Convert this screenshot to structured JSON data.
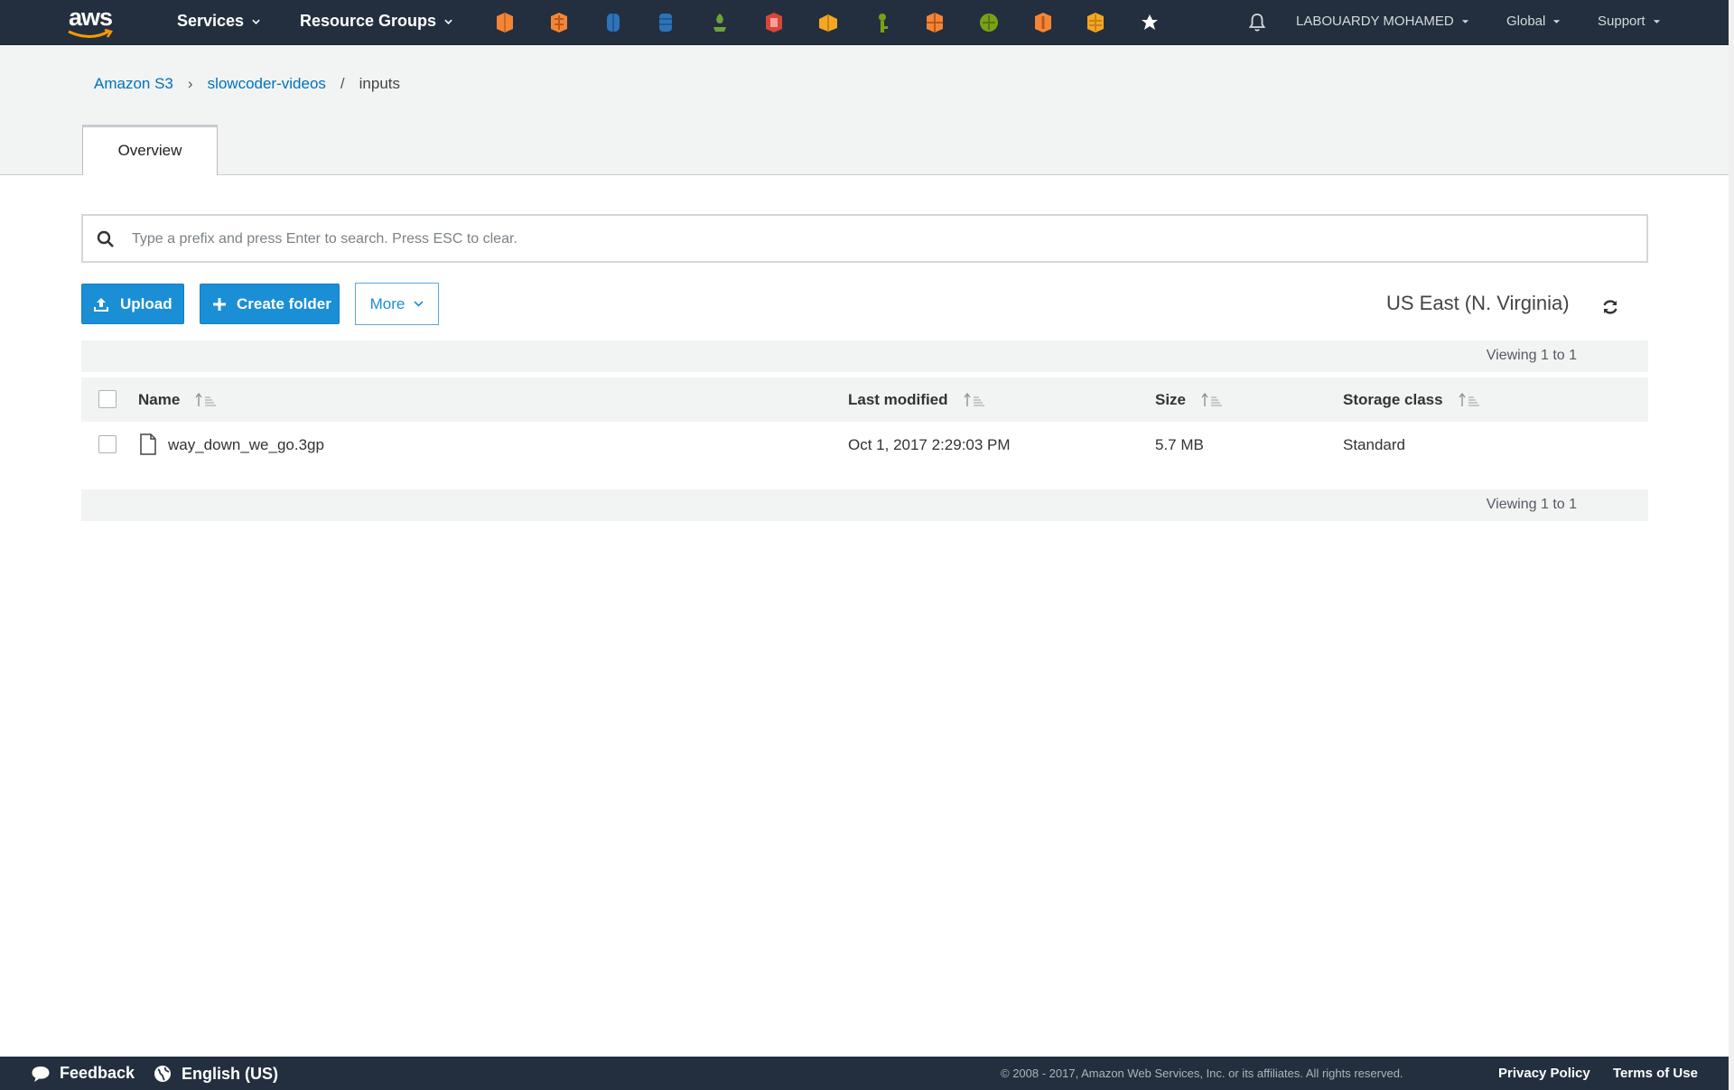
{
  "topnav": {
    "logo_text": "aws",
    "services_label": "Services",
    "resource_groups_label": "Resource Groups",
    "shortcut_colors": [
      "#f58536",
      "#f58536",
      "#2e73b8",
      "#2e73b8",
      "#6ba539",
      "#d9453a",
      "#f5a623",
      "#7aa116",
      "#f58536",
      "#7aa116",
      "#f58536",
      "#f5a623"
    ],
    "account_label": "LABOUARDY MOHAMED",
    "region_menu_label": "Global",
    "support_label": "Support"
  },
  "breadcrumb": {
    "root": "Amazon S3",
    "bucket": "slowcoder-videos",
    "folder": "inputs"
  },
  "tabs": {
    "overview_label": "Overview"
  },
  "search": {
    "placeholder": "Type a prefix and press Enter to search. Press ESC to clear.",
    "value": ""
  },
  "actions": {
    "upload_label": "Upload",
    "create_folder_label": "Create folder",
    "more_label": "More"
  },
  "region": {
    "label": "US East (N. Virginia)"
  },
  "table": {
    "viewing_top": "Viewing 1 to 1",
    "viewing_bottom": "Viewing 1 to 1",
    "headers": {
      "name": "Name",
      "last_modified": "Last modified",
      "size": "Size",
      "storage_class": "Storage class"
    },
    "rows": [
      {
        "name": "way_down_we_go.3gp",
        "last_modified": "Oct 1, 2017 2:29:03 PM",
        "size": "5.7 MB",
        "storage_class": "Standard"
      }
    ]
  },
  "footer": {
    "feedback_label": "Feedback",
    "language_label": "English (US)",
    "copyright": "© 2008 - 2017, Amazon Web Services, Inc. or its affiliates. All rights reserved.",
    "privacy_label": "Privacy Policy",
    "terms_label": "Terms of Use"
  }
}
